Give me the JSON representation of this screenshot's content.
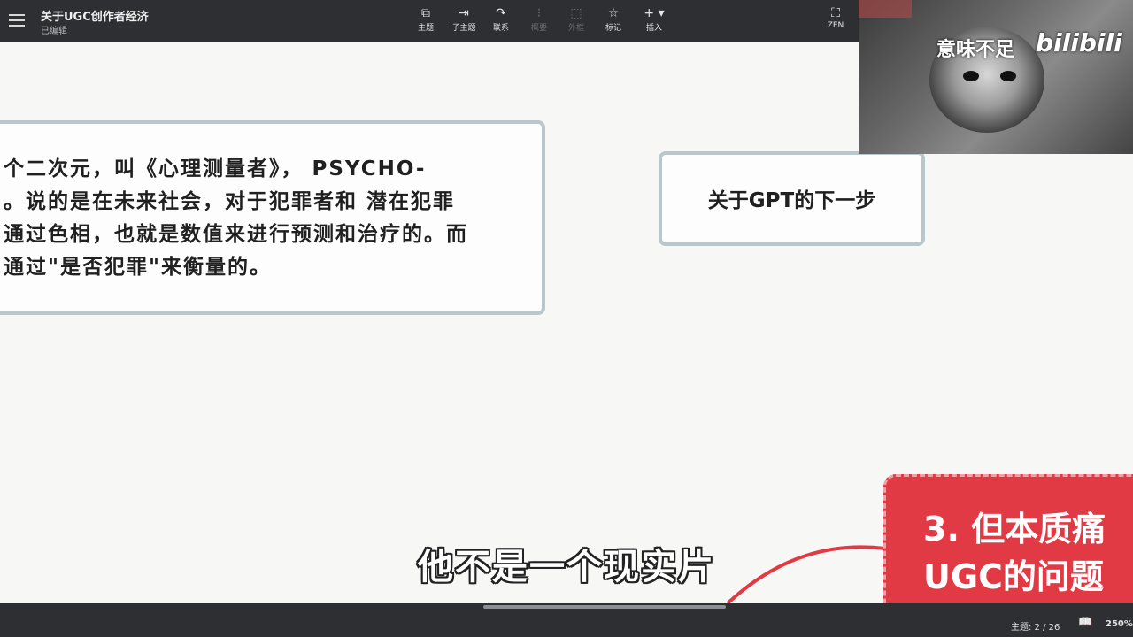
{
  "header": {
    "title": "关于UGC创作者经济",
    "status": "已编辑",
    "tools": [
      {
        "label": "主题",
        "icon": "topic-icon",
        "glyph": "⧉",
        "enabled": true
      },
      {
        "label": "子主题",
        "icon": "subtopic-icon",
        "glyph": "⇥",
        "enabled": true
      },
      {
        "label": "联系",
        "icon": "relationship-icon",
        "glyph": "↷",
        "enabled": true
      },
      {
        "label": "概要",
        "icon": "summary-icon",
        "glyph": "⁝",
        "enabled": false
      },
      {
        "label": "外框",
        "icon": "boundary-icon",
        "glyph": "⬚",
        "enabled": false
      },
      {
        "label": "标记",
        "icon": "star-icon",
        "glyph": "☆",
        "enabled": true
      },
      {
        "label": "插入",
        "icon": "plus-icon",
        "glyph": "+ ▾",
        "enabled": true
      }
    ],
    "zen_label": "ZEN",
    "zen_glyph": "⛶"
  },
  "canvas": {
    "main_node_lines": [
      "个二次元，叫《心理测量者》， PSYCHO-",
      "。说的是在未来社会，对于犯罪者和 潜在犯罪",
      "通过色相，也就是数值来进行预测和治疗的。而",
      "通过\"是否犯罪\"来衡量的。"
    ],
    "gpt_node": "关于GPT的下一步",
    "red_node_line1": "3. 但本质痛",
    "red_node_line2": "UGC的问题",
    "subtitle": "他不是一个现实片",
    "red_color": "#e23a45"
  },
  "video": {
    "watermark": "意味不足",
    "logo": "bilibili"
  },
  "footer": {
    "topic_count": "主题: 2 / 26",
    "zoom": "250%"
  }
}
